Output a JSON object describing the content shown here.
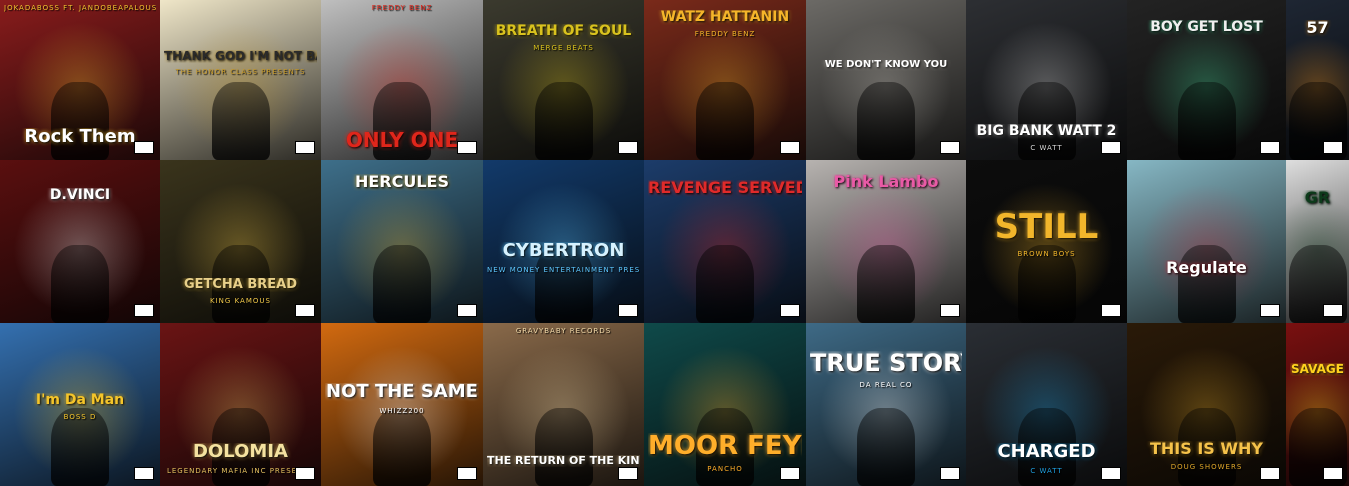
{
  "covers": [
    {
      "title": "Rock Them",
      "subtitle": "JOKADABOSS FT. JANDOBEAPALOUS",
      "bg": "#8a1c1c",
      "accent": "#f2c230",
      "ink": "#ffffff"
    },
    {
      "title": "THANK GOD I'M NOT BASIC",
      "subtitle": "THE HONOR CLASS PRESENTS",
      "bg": "#efe6c8",
      "accent": "#c79a2a",
      "ink": "#2a2a2a"
    },
    {
      "title": "ONLY ONE",
      "subtitle": "FREDDY BENZ",
      "bg": "#bfbfbf",
      "accent": "#e0261b",
      "ink": "#e0261b"
    },
    {
      "title": "BREATH OF SOUL",
      "subtitle": "MERGE BEATS",
      "bg": "#3b3a2e",
      "accent": "#d9c21e",
      "ink": "#d9c21e"
    },
    {
      "title": "WATZ HATTANIN",
      "subtitle": "FREDDY BENZ",
      "bg": "#7a2a1a",
      "accent": "#f5b52a",
      "ink": "#f5b52a"
    },
    {
      "title": "WE DON'T KNOW YOU",
      "subtitle": "",
      "bg": "#6c6a66",
      "accent": "#c9c5bd",
      "ink": "#ffffff"
    },
    {
      "title": "BIG BANK WATT 2",
      "subtitle": "C WATT",
      "bg": "#2d2f33",
      "accent": "#d8d8d8",
      "ink": "#ffffff"
    },
    {
      "title": "BOY GET LOST",
      "subtitle": "",
      "bg": "#232323",
      "accent": "#4be2a0",
      "ink": "#f0f0f0"
    },
    {
      "title": "57",
      "subtitle": "",
      "bg": "#1e2633",
      "accent": "#ff9b1e",
      "ink": "#ffffff"
    },
    {
      "title": "D.VINCI",
      "subtitle": "",
      "bg": "#5a0f0f",
      "accent": "#e8e8e8",
      "ink": "#ffffff"
    },
    {
      "title": "GETCHA BREAD",
      "subtitle": "KING KAMOUS",
      "bg": "#3a341c",
      "accent": "#f0c84a",
      "ink": "#e8d08a"
    },
    {
      "title": "HERCULES",
      "subtitle": "",
      "bg": "#3e6f8a",
      "accent": "#e6b331",
      "ink": "#ffffff"
    },
    {
      "title": "CYBERTRON",
      "subtitle": "NEW MONEY ENTERTAINMENT PRESENTS",
      "bg": "#123a6a",
      "accent": "#5ec7ff",
      "ink": "#d6f2ff"
    },
    {
      "title": "REVENGE SERVED COLD",
      "subtitle": "",
      "bg": "#1c3c6a",
      "accent": "#e02a2a",
      "ink": "#e02a2a"
    },
    {
      "title": "Pink Lambo",
      "subtitle": "",
      "bg": "#b7b3b0",
      "accent": "#e95aa6",
      "ink": "#e95aa6"
    },
    {
      "title": "STILL",
      "subtitle": "BROWN BOYS",
      "bg": "#0d0d0d",
      "accent": "#f2b62b",
      "ink": "#f2b62b"
    },
    {
      "title": "Regulate",
      "subtitle": "",
      "bg": "#86b7c4",
      "accent": "#c42a3a",
      "ink": "#ffffff"
    },
    {
      "title": "GR",
      "subtitle": "",
      "bg": "#dedede",
      "accent": "#0c3a1a",
      "ink": "#0c3a1a"
    },
    {
      "title": "I'm Da Man",
      "subtitle": "BOSS D",
      "bg": "#3470b0",
      "accent": "#f5c52a",
      "ink": "#f5c52a"
    },
    {
      "title": "DOLOMIA",
      "subtitle": "LEGENDARY MAFIA INC PRESENTS",
      "bg": "#6a1414",
      "accent": "#e4c060",
      "ink": "#f4e2a0"
    },
    {
      "title": "NOT THE SAME",
      "subtitle": "WHIZZ200",
      "bg": "#d26a10",
      "accent": "#ffffff",
      "ink": "#ffffff"
    },
    {
      "title": "THE RETURN OF THE KING",
      "subtitle": "GRAVYBABY RECORDS",
      "bg": "#8a6a4a",
      "accent": "#f0d8a8",
      "ink": "#ffffff"
    },
    {
      "title": "MOOR FEYER",
      "subtitle": "PANCHO",
      "bg": "#0f4a4a",
      "accent": "#ffae2a",
      "ink": "#ffae2a"
    },
    {
      "title": "TRUE STORY",
      "subtitle": "DA REAL CO",
      "bg": "#3e6a86",
      "accent": "#ffffff",
      "ink": "#ffffff"
    },
    {
      "title": "CHARGED",
      "subtitle": "C WATT",
      "bg": "#2a2e34",
      "accent": "#1fa0e0",
      "ink": "#ffffff"
    },
    {
      "title": "THIS IS WHY",
      "subtitle": "DOUG SHOWERS",
      "bg": "#2a1a08",
      "accent": "#e0a82a",
      "ink": "#f5c24a"
    },
    {
      "title": "SAVAGE",
      "subtitle": "",
      "bg": "#7a1010",
      "accent": "#ffd21e",
      "ink": "#ffd21e"
    }
  ]
}
